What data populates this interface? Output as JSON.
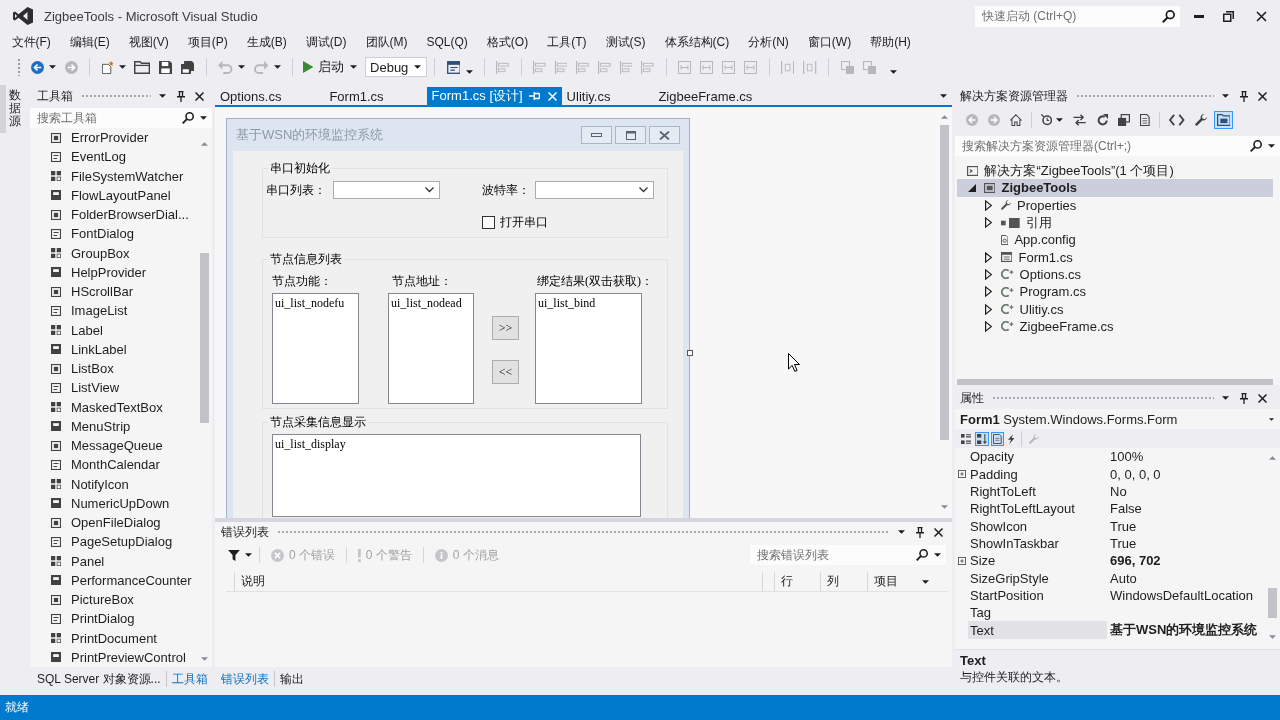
{
  "window": {
    "title": "ZigbeeTools - Microsoft Visual Studio",
    "quick_launch": {
      "placeholder": "快速启动 (Ctrl+Q)"
    }
  },
  "menu": [
    "文件(F)",
    "编辑(E)",
    "视图(V)",
    "项目(P)",
    "生成(B)",
    "调试(D)",
    "团队(M)",
    "SQL(Q)",
    "格式(O)",
    "工具(T)",
    "测试(S)",
    "体系结构(C)",
    "分析(N)",
    "窗口(W)",
    "帮助(H)"
  ],
  "toolbar": {
    "groups": [
      [
        {
          "kind": "back",
          "disabled": false,
          "dropdown": true
        },
        {
          "kind": "forward",
          "disabled": true,
          "dropdown": false
        }
      ],
      [
        {
          "kind": "new_item",
          "disabled": false,
          "dropdown": true
        },
        {
          "kind": "open",
          "disabled": false,
          "dropdown": false
        },
        {
          "kind": "save",
          "disabled": false,
          "dropdown": false
        },
        {
          "kind": "save_all",
          "disabled": false,
          "dropdown": false
        }
      ],
      [
        {
          "kind": "undo",
          "disabled": true,
          "dropdown": true
        },
        {
          "kind": "redo",
          "disabled": true,
          "dropdown": true
        }
      ],
      [
        {
          "kind": "start",
          "label": "启动",
          "disabled": false,
          "dropdown": true
        },
        {
          "kind": "combo",
          "value": "Debug",
          "disabled": false,
          "dropdown": true
        }
      ],
      [
        {
          "kind": "window",
          "disabled": false,
          "dropdown": true
        }
      ],
      [
        {
          "kind": "align",
          "disabled": true,
          "dropdown": false
        }
      ],
      [
        {
          "kind": "align",
          "disabled": true,
          "dropdown": false
        },
        {
          "kind": "align",
          "disabled": true,
          "dropdown": false
        },
        {
          "kind": "align",
          "disabled": true,
          "dropdown": false
        },
        {
          "kind": "align",
          "disabled": true,
          "dropdown": false
        },
        {
          "kind": "align",
          "disabled": true,
          "dropdown": false
        },
        {
          "kind": "align",
          "disabled": true,
          "dropdown": false
        }
      ],
      [
        {
          "kind": "size",
          "disabled": true,
          "dropdown": false
        },
        {
          "kind": "size",
          "disabled": true,
          "dropdown": false
        },
        {
          "kind": "size",
          "disabled": true,
          "dropdown": false
        },
        {
          "kind": "size",
          "disabled": true,
          "dropdown": false
        }
      ],
      [
        {
          "kind": "spacing",
          "disabled": true,
          "dropdown": false
        },
        {
          "kind": "spacing",
          "disabled": true,
          "dropdown": false
        }
      ],
      [
        {
          "kind": "order",
          "disabled": true,
          "dropdown": false
        },
        {
          "kind": "order",
          "disabled": true,
          "dropdown": false
        }
      ]
    ]
  },
  "side_tabs": [
    {
      "label": "数据源"
    }
  ],
  "toolbox": {
    "title": "工具箱",
    "search": {
      "placeholder": "搜索工具箱"
    },
    "items": [
      "ErrorProvider",
      "EventLog",
      "FileSystemWatcher",
      "FlowLayoutPanel",
      "FolderBrowserDial...",
      "FontDialog",
      "GroupBox",
      "HelpProvider",
      "HScrollBar",
      "ImageList",
      "Label",
      "LinkLabel",
      "ListBox",
      "ListView",
      "MaskedTextBox",
      "MenuStrip",
      "MessageQueue",
      "MonthCalendar",
      "NotifyIcon",
      "NumericUpDown",
      "OpenFileDialog",
      "PageSetupDialog",
      "Panel",
      "PerformanceCounter",
      "PictureBox",
      "PrintDialog",
      "PrintDocument",
      "PrintPreviewControl"
    ],
    "tabs": [
      {
        "label": "SQL Server 对象资源...",
        "selected": false
      },
      {
        "label": "工具箱",
        "selected": true
      }
    ]
  },
  "document_tabs": [
    {
      "label": "Options.cs",
      "selected": false
    },
    {
      "label": "Form1.cs",
      "selected": false
    },
    {
      "label": "Form1.cs [设计]",
      "selected": true
    },
    {
      "label": "Ulitiy.cs",
      "selected": false
    },
    {
      "label": "ZigbeeFrame.cs",
      "selected": false
    }
  ],
  "designer": {
    "form": {
      "title": "基于WSN的环境监控系统",
      "groups": [
        {
          "kind": "serial",
          "title": "串口初始化",
          "combos": [
            {
              "label": "串口列表："
            },
            {
              "label": "波特率："
            }
          ],
          "checkbox": {
            "label": "打开串口",
            "checked": false
          }
        },
        {
          "kind": "nodes",
          "title": "节点信息列表",
          "lists": [
            {
              "label": "节点功能：",
              "item": "ui_list_nodefu"
            },
            {
              "label": "节点地址：",
              "item": "ui_list_nodead"
            },
            {
              "label": "绑定结果(双击获取)：",
              "item": "ui_list_bind"
            }
          ],
          "buttons": [
            ">>",
            "<<"
          ]
        },
        {
          "kind": "display",
          "title": "节点采集信息显示",
          "list": {
            "item": "ui_list_display"
          }
        }
      ]
    }
  },
  "error_list": {
    "title": "错误列表",
    "filters": [
      {
        "kind": "error",
        "label": "0 个错误",
        "disabled": true
      },
      {
        "kind": "warning",
        "label": "0 个警告",
        "disabled": true
      },
      {
        "kind": "message",
        "label": "0 个消息",
        "disabled": true
      }
    ],
    "search": {
      "placeholder": "搜索错误列表"
    },
    "columns": [
      {
        "label": "说明",
        "dropdown": false
      },
      {
        "label": "行",
        "dropdown": false
      },
      {
        "label": "列",
        "dropdown": false
      },
      {
        "label": "项目",
        "dropdown": true
      }
    ]
  },
  "output_tabs": [
    {
      "label": "错误列表",
      "selected": true
    },
    {
      "label": "输出",
      "selected": false
    }
  ],
  "solution_explorer": {
    "title": "解决方案资源管理器",
    "toolbar": [
      [
        {
          "kind": "back",
          "disabled": true,
          "selected": false,
          "dropdown": false
        },
        {
          "kind": "forward",
          "disabled": true,
          "selected": false,
          "dropdown": false
        },
        {
          "kind": "home",
          "disabled": false,
          "selected": false,
          "dropdown": false
        }
      ],
      [
        {
          "kind": "pending",
          "disabled": false,
          "selected": false,
          "dropdown": true
        },
        {
          "kind": "sync",
          "disabled": false,
          "selected": false,
          "dropdown": false
        },
        {
          "kind": "refresh",
          "disabled": false,
          "selected": false,
          "dropdown": false
        },
        {
          "kind": "collapse",
          "disabled": false,
          "selected": false,
          "dropdown": false
        },
        {
          "kind": "show_all",
          "disabled": false,
          "selected": false,
          "dropdown": false
        }
      ],
      [
        {
          "kind": "code",
          "disabled": false,
          "selected": false,
          "dropdown": false
        },
        {
          "kind": "wrench",
          "disabled": false,
          "selected": false,
          "dropdown": false
        },
        {
          "kind": "preview",
          "disabled": false,
          "selected": true,
          "dropdown": false
        }
      ]
    ],
    "search": {
      "placeholder": "搜索解决方案资源管理器(Ctrl+;)"
    },
    "tree": [
      {
        "kind": "solution",
        "label": "解决方案“ZigbeeTools”(1 个项目)",
        "has_expander": false,
        "expanded": true,
        "selected": false,
        "children": [
          {
            "kind": "project",
            "label": "ZigbeeTools",
            "has_expander": true,
            "expanded": true,
            "selected": true,
            "children": [
              {
                "kind": "properties",
                "label": "Properties",
                "has_expander": true,
                "expanded": false,
                "selected": false
              },
              {
                "kind": "references",
                "label": "引用",
                "has_expander": true,
                "expanded": false,
                "selected": false
              },
              {
                "kind": "config",
                "label": "App.config",
                "has_expander": false,
                "selected": false
              },
              {
                "kind": "form",
                "label": "Form1.cs",
                "has_expander": true,
                "expanded": false,
                "selected": false
              },
              {
                "kind": "csharp",
                "label": "Options.cs",
                "has_expander": true,
                "expanded": false,
                "selected": false
              },
              {
                "kind": "csharp",
                "label": "Program.cs",
                "has_expander": true,
                "expanded": false,
                "selected": false
              },
              {
                "kind": "csharp",
                "label": "Ulitiy.cs",
                "has_expander": true,
                "expanded": false,
                "selected": false
              },
              {
                "kind": "csharp",
                "label": "ZigbeeFrame.cs",
                "has_expander": true,
                "expanded": false,
                "selected": false
              }
            ]
          }
        ]
      }
    ]
  },
  "properties": {
    "title": "属性",
    "object": "**Form1** System.Windows.Forms.Form",
    "toolbar": [
      [
        {
          "kind": "categorized",
          "selected": false,
          "disabled": false
        },
        {
          "kind": "alphabetical",
          "selected": true,
          "disabled": false
        },
        {
          "kind": "property_view",
          "selected": true,
          "disabled": false
        },
        {
          "kind": "events",
          "selected": false,
          "disabled": false
        }
      ],
      [
        {
          "kind": "wrench",
          "selected": false,
          "disabled": true
        }
      ]
    ],
    "rows": [
      {
        "name": "Opacity",
        "value": "100%",
        "expandable": false,
        "modified": false,
        "selected": false
      },
      {
        "name": "Padding",
        "value": "0, 0, 0, 0",
        "expandable": true,
        "modified": false,
        "selected": false
      },
      {
        "name": "RightToLeft",
        "value": "No",
        "expandable": false,
        "modified": false,
        "selected": false
      },
      {
        "name": "RightToLeftLayout",
        "value": "False",
        "expandable": false,
        "modified": false,
        "selected": false
      },
      {
        "name": "ShowIcon",
        "value": "True",
        "expandable": false,
        "modified": false,
        "selected": false
      },
      {
        "name": "ShowInTaskbar",
        "value": "True",
        "expandable": false,
        "modified": false,
        "selected": false
      },
      {
        "name": "Size",
        "value": "696, 702",
        "expandable": true,
        "modified": true,
        "selected": false
      },
      {
        "name": "SizeGripStyle",
        "value": "Auto",
        "expandable": false,
        "modified": false,
        "selected": false
      },
      {
        "name": "StartPosition",
        "value": "WindowsDefaultLocation",
        "expandable": false,
        "modified": false,
        "selected": false
      },
      {
        "name": "Tag",
        "expandable": false,
        "selected": false
      },
      {
        "name": "Text",
        "value": "基于WSN的环境监控系统",
        "expandable": false,
        "modified": true,
        "selected": true
      }
    ],
    "description": {
      "title": "Text",
      "text": "与控件关联的文本。"
    }
  },
  "status_bar": {
    "text": "就绪"
  }
}
